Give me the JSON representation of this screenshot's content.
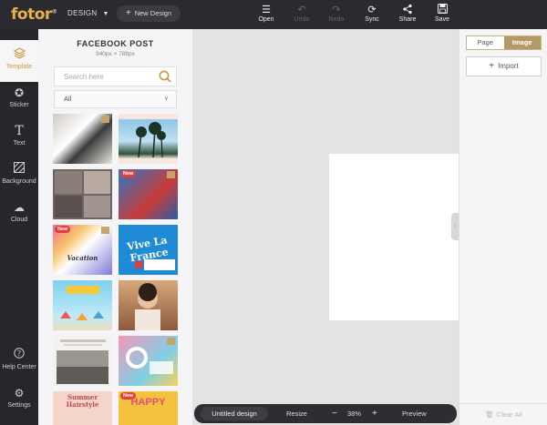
{
  "app": {
    "logo_text": "fotor",
    "logo_mark": "®",
    "design_menu": "DESIGN",
    "new_design": "New Design"
  },
  "toolbar": {
    "open": "Open",
    "undo": "Undo",
    "redo": "Redo",
    "sync": "Sync",
    "share": "Share",
    "save": "Save"
  },
  "rail": {
    "template": "Template",
    "sticker": "Sticker",
    "text": "Text",
    "background": "Background",
    "cloud": "Cloud",
    "help": "Help Center",
    "settings": "Settings"
  },
  "panel": {
    "title": "FACEBOOK POST",
    "size": "940px × 788px",
    "search_placeholder": "Search here",
    "filter_selected": "All"
  },
  "thumbs": [
    {
      "caption": "",
      "badge_new": "",
      "badge_crown": true
    },
    {
      "caption": "",
      "badge_new": "",
      "badge_crown": false
    },
    {
      "caption": "",
      "badge_new": "",
      "badge_crown": false
    },
    {
      "caption": "",
      "badge_new": "New",
      "badge_crown": true
    },
    {
      "caption": "Vacation",
      "badge_new": "New",
      "badge_crown": true
    },
    {
      "caption": "Vive La France",
      "badge_new": "",
      "badge_crown": false
    },
    {
      "caption": "",
      "badge_new": "",
      "badge_crown": false
    },
    {
      "caption": "",
      "badge_new": "",
      "badge_crown": false
    },
    {
      "caption": "",
      "badge_new": "",
      "badge_crown": false
    },
    {
      "caption": "",
      "badge_new": "",
      "badge_crown": true
    },
    {
      "caption": "Summer Hairstyle",
      "badge_new": "",
      "badge_crown": false
    },
    {
      "caption": "HAPPY",
      "badge_new": "New",
      "badge_crown": false
    }
  ],
  "bottombar": {
    "design_name": "Untitled design",
    "resize": "Resize",
    "zoom_minus": "−",
    "zoom": "38%",
    "zoom_plus": "+",
    "preview": "Preview"
  },
  "rightpanel": {
    "tab_page": "Page",
    "tab_image": "Image",
    "import": "Import",
    "clear_all": "Clear All"
  },
  "colors": {
    "accent": "#c99b3c",
    "topbar": "#2b2b2f",
    "rail": "#27272b"
  }
}
